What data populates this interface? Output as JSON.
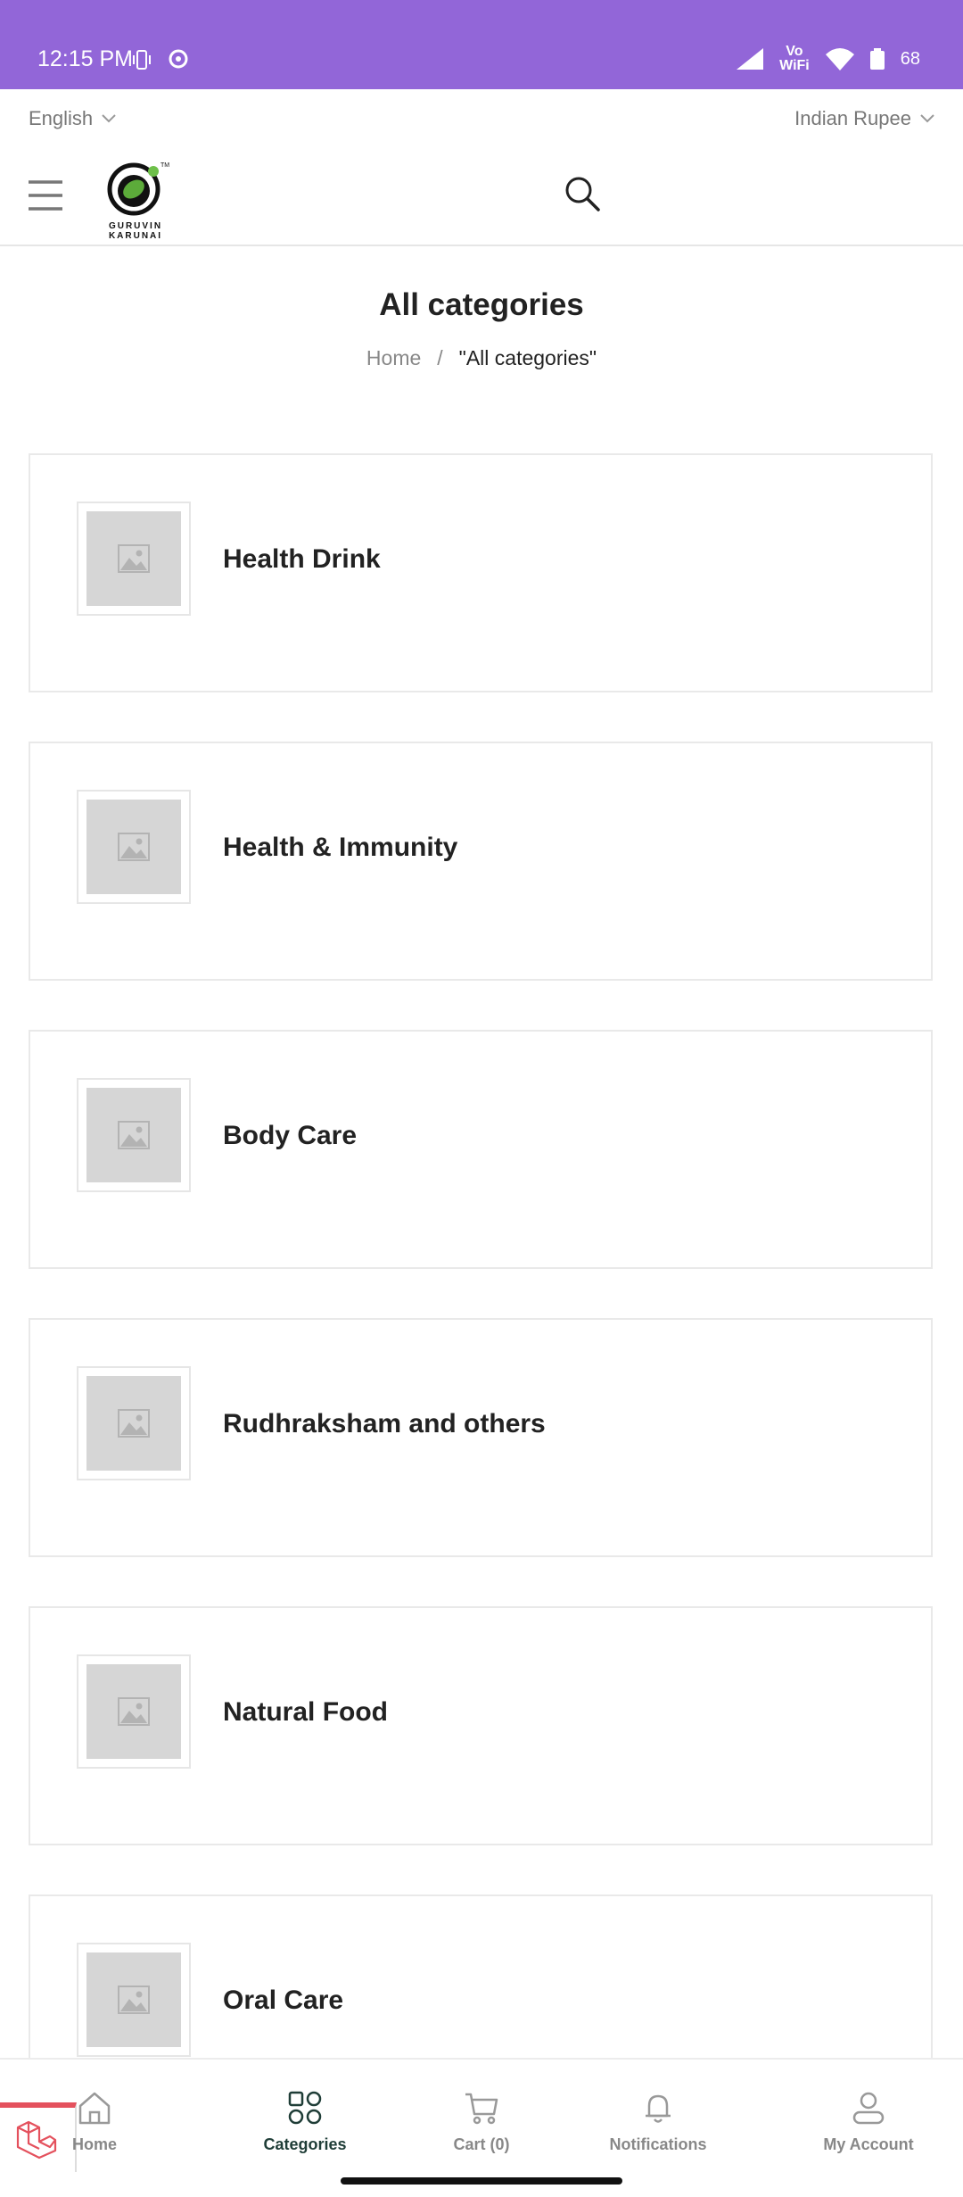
{
  "status_bar": {
    "time": "12:15 PM",
    "network": "Vo\nWiFi",
    "battery": "68"
  },
  "topbar": {
    "language": "English",
    "currency": "Indian Rupee"
  },
  "logo": {
    "line1": "GURUVIN",
    "line2": "KARUNAI"
  },
  "page": {
    "title": "All categories",
    "breadcrumb": {
      "home": "Home",
      "separator": "/",
      "current": "\"All categories\""
    }
  },
  "categories": [
    {
      "label": "Health Drink"
    },
    {
      "label": "Health & Immunity"
    },
    {
      "label": "Body Care"
    },
    {
      "label": "Rudhraksham and others"
    },
    {
      "label": "Natural Food"
    },
    {
      "label": "Oral Care"
    }
  ],
  "bottom_nav": {
    "home": "Home",
    "categories": "Categories",
    "cart": "Cart (0)",
    "notifications": "Notifications",
    "account": "My Account"
  },
  "colors": {
    "status_bar": "#9266d8",
    "active_nav": "#1f3d37",
    "laravel_red": "#e4515d"
  }
}
